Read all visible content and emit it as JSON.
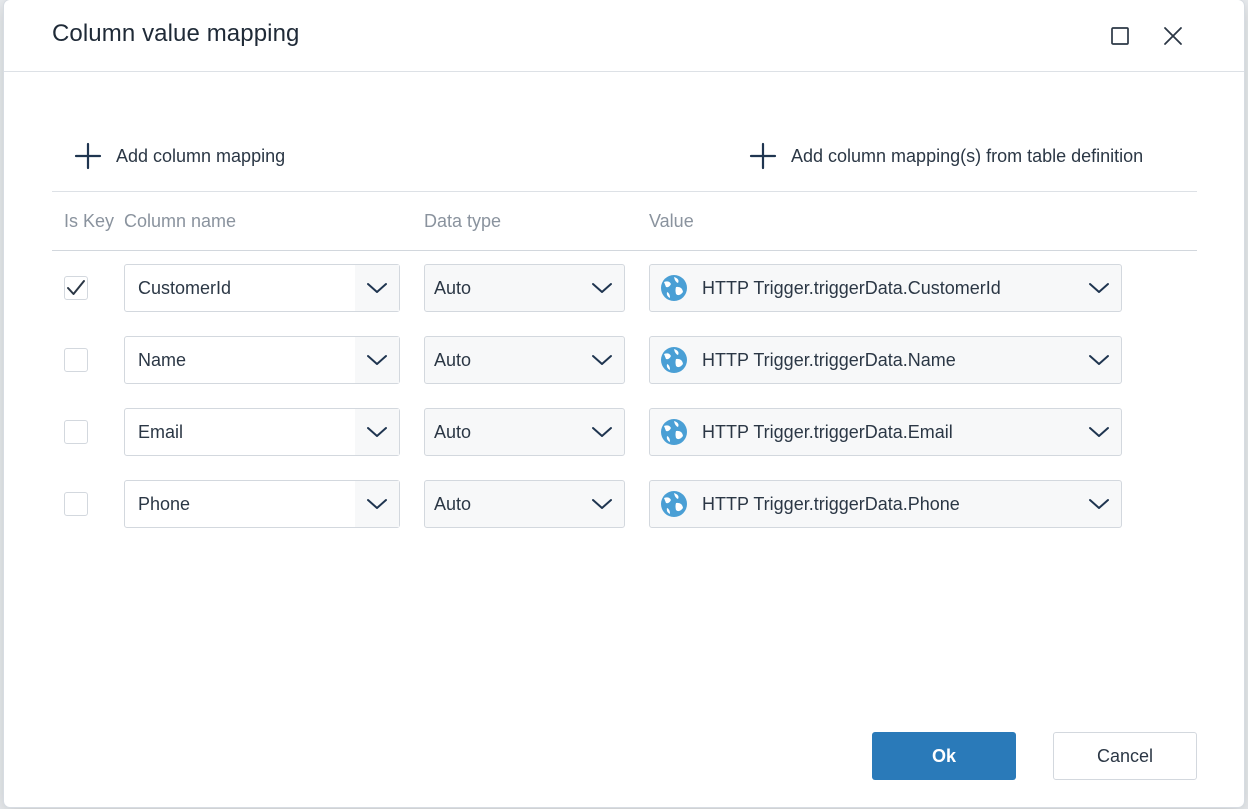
{
  "dialog": {
    "title": "Column value mapping",
    "maximize_icon": "square-icon",
    "close_icon": "close-icon"
  },
  "toolbar": {
    "add_mapping_label": "Add column mapping",
    "add_from_table_label": "Add column mapping(s) from table definition",
    "plus_icon": "plus-icon"
  },
  "table": {
    "headers": {
      "is_key": "Is Key",
      "column_name": "Column name",
      "data_type": "Data type",
      "value": "Value"
    },
    "rows": [
      {
        "is_key": true,
        "column_name": "CustomerId",
        "data_type": "Auto",
        "value": "HTTP Trigger.triggerData.CustomerId"
      },
      {
        "is_key": false,
        "column_name": "Name",
        "data_type": "Auto",
        "value": "HTTP Trigger.triggerData.Name"
      },
      {
        "is_key": false,
        "column_name": "Email",
        "data_type": "Auto",
        "value": "HTTP Trigger.triggerData.Email"
      },
      {
        "is_key": false,
        "column_name": "Phone",
        "data_type": "Auto",
        "value": "HTTP Trigger.triggerData.Phone"
      }
    ]
  },
  "footer": {
    "ok_label": "Ok",
    "cancel_label": "Cancel"
  },
  "colors": {
    "primary": "#2a7ab9",
    "globe": "#4a9fd5",
    "text": "#2b3745",
    "muted": "#8a939e"
  }
}
